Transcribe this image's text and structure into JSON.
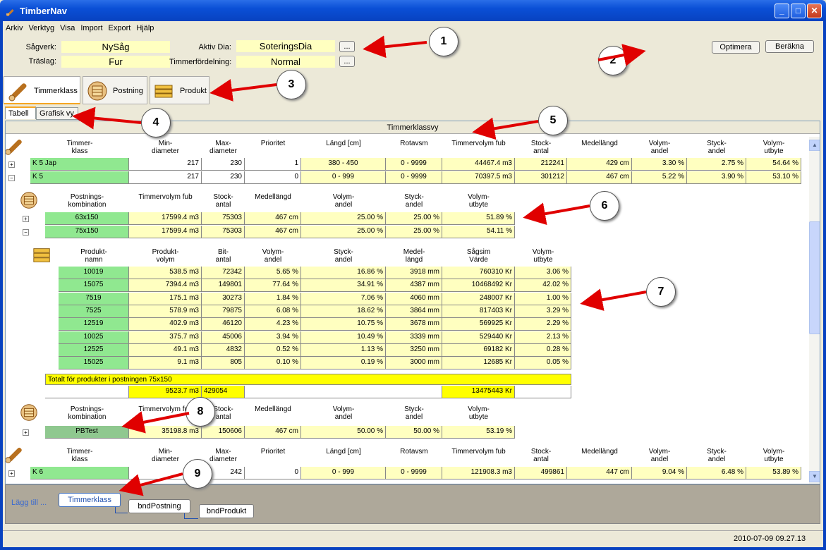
{
  "window": {
    "title": "TimberNav",
    "min": "_",
    "max": "□",
    "close": "✕"
  },
  "menu": [
    "Arkiv",
    "Verktyg",
    "Visa",
    "Import",
    "Export",
    "Hjälp"
  ],
  "form": {
    "sagverk_label": "Sågverk:",
    "sagverk": "NySåg",
    "traslag_label": "Träslag:",
    "traslag": "Fur",
    "aktiv_dia_label": "Aktiv Dia:",
    "aktiv_dia": "SoteringsDia",
    "timmerfordelning_label": "Timmerfördelning:",
    "timmerfordelning": "Normal",
    "browse": "..."
  },
  "actions": {
    "optimera": "Optimera",
    "berakna": "Beräkna"
  },
  "views": {
    "timmerklass": "Timmerklass",
    "postning": "Postning",
    "produkt": "Produkt"
  },
  "tabs": {
    "tabell": "Tabell",
    "grafisk": "Grafisk vy"
  },
  "grid_title": "Timmerklassvy",
  "timmer_headers": [
    "Timmer-\nklass",
    "Min-\ndiameter",
    "Max-\ndiameter",
    "Prioritet",
    "Längd [cm]",
    "Rotavsm",
    "Timmervolym fub",
    "Stock-\nantal",
    "Medellängd",
    "Volym-\nandel",
    "Styck-\nandel",
    "Volym-\nutbyte"
  ],
  "timmer_rows": [
    [
      "K 5 Jap",
      "217",
      "230",
      "1",
      "380 - 450",
      "0 - 9999",
      "44467.4 m3",
      "212241",
      "429 cm",
      "3.30 %",
      "2.75 %",
      "54.64 %"
    ],
    [
      "K 5",
      "217",
      "230",
      "0",
      "0 - 999",
      "0 - 9999",
      "70397.5 m3",
      "301212",
      "467 cm",
      "5.22 %",
      "3.90 %",
      "53.10 %"
    ]
  ],
  "postning_headers": [
    "Postnings-\nkombination",
    "Timmervolym fub",
    "Stock-\nantal",
    "Medellängd",
    "Volym-\nandel",
    "Styck-\nandel",
    "Volym-\nutbyte"
  ],
  "postning_rows": [
    [
      "63x150",
      "17599.4 m3",
      "75303",
      "467 cm",
      "25.00 %",
      "25.00 %",
      "51.89 %"
    ],
    [
      "75x150",
      "17599.4 m3",
      "75303",
      "467 cm",
      "25.00 %",
      "25.00 %",
      "54.11 %"
    ]
  ],
  "produkt_headers": [
    "Produkt-\nnamn",
    "Produkt-\nvolym",
    "Bit-\nantal",
    "Volym-\nandel",
    "Styck-\nandel",
    "Medel-\nlängd",
    "Sågsim\nVärde",
    "Volym-\nutbyte"
  ],
  "produkt_rows": [
    [
      "10019",
      "538.5 m3",
      "72342",
      "5.65 %",
      "16.86 %",
      "3918 mm",
      "760310 Kr",
      "3.06 %"
    ],
    [
      "15075",
      "7394.4 m3",
      "149801",
      "77.64 %",
      "34.91 %",
      "4387 mm",
      "10468492 Kr",
      "42.02 %"
    ],
    [
      "7519",
      "175.1 m3",
      "30273",
      "1.84 %",
      "7.06 %",
      "4060 mm",
      "248007 Kr",
      "1.00 %"
    ],
    [
      "7525",
      "578.9 m3",
      "79875",
      "6.08 %",
      "18.62 %",
      "3864 mm",
      "817403 Kr",
      "3.29 %"
    ],
    [
      "12519",
      "402.9 m3",
      "46120",
      "4.23 %",
      "10.75 %",
      "3678 mm",
      "569925 Kr",
      "2.29 %"
    ],
    [
      "10025",
      "375.7 m3",
      "45006",
      "3.94 %",
      "10.49 %",
      "3339 mm",
      "529440 Kr",
      "2.13 %"
    ],
    [
      "12525",
      "49.1 m3",
      "4832",
      "0.52 %",
      "1.13 %",
      "3250 mm",
      "69182 Kr",
      "0.28 %"
    ],
    [
      "15025",
      "9.1 m3",
      "805",
      "0.10 %",
      "0.19 %",
      "3000 mm",
      "12685 Kr",
      "0.05 %"
    ]
  ],
  "total": {
    "label": "Totalt för produkter i postningen 75x150",
    "volym": "9523.7 m3",
    "antal": "429054",
    "varde": "13475443 Kr"
  },
  "postning2_row": [
    "PBTest",
    "35198.8 m3",
    "150606",
    "467 cm",
    "50.00 %",
    "50.00 %",
    "53.19 %"
  ],
  "timmer2_row": [
    "K 6",
    "",
    "242",
    "0",
    "0 - 999",
    "0 - 9999",
    "121908.3 m3",
    "499861",
    "447 cm",
    "9.04 %",
    "6.48 %",
    "53.89 %"
  ],
  "bottom": {
    "lagg_till": "Lägg till ...",
    "timmerklass": "Timmerklass",
    "bndPostning": "bndPostning",
    "bndProdukt": "bndProdukt"
  },
  "status": {
    "datetime": "2010-07-09 09.27.13"
  },
  "callouts": [
    "1",
    "2",
    "3",
    "4",
    "5",
    "6",
    "7",
    "8",
    "9"
  ]
}
